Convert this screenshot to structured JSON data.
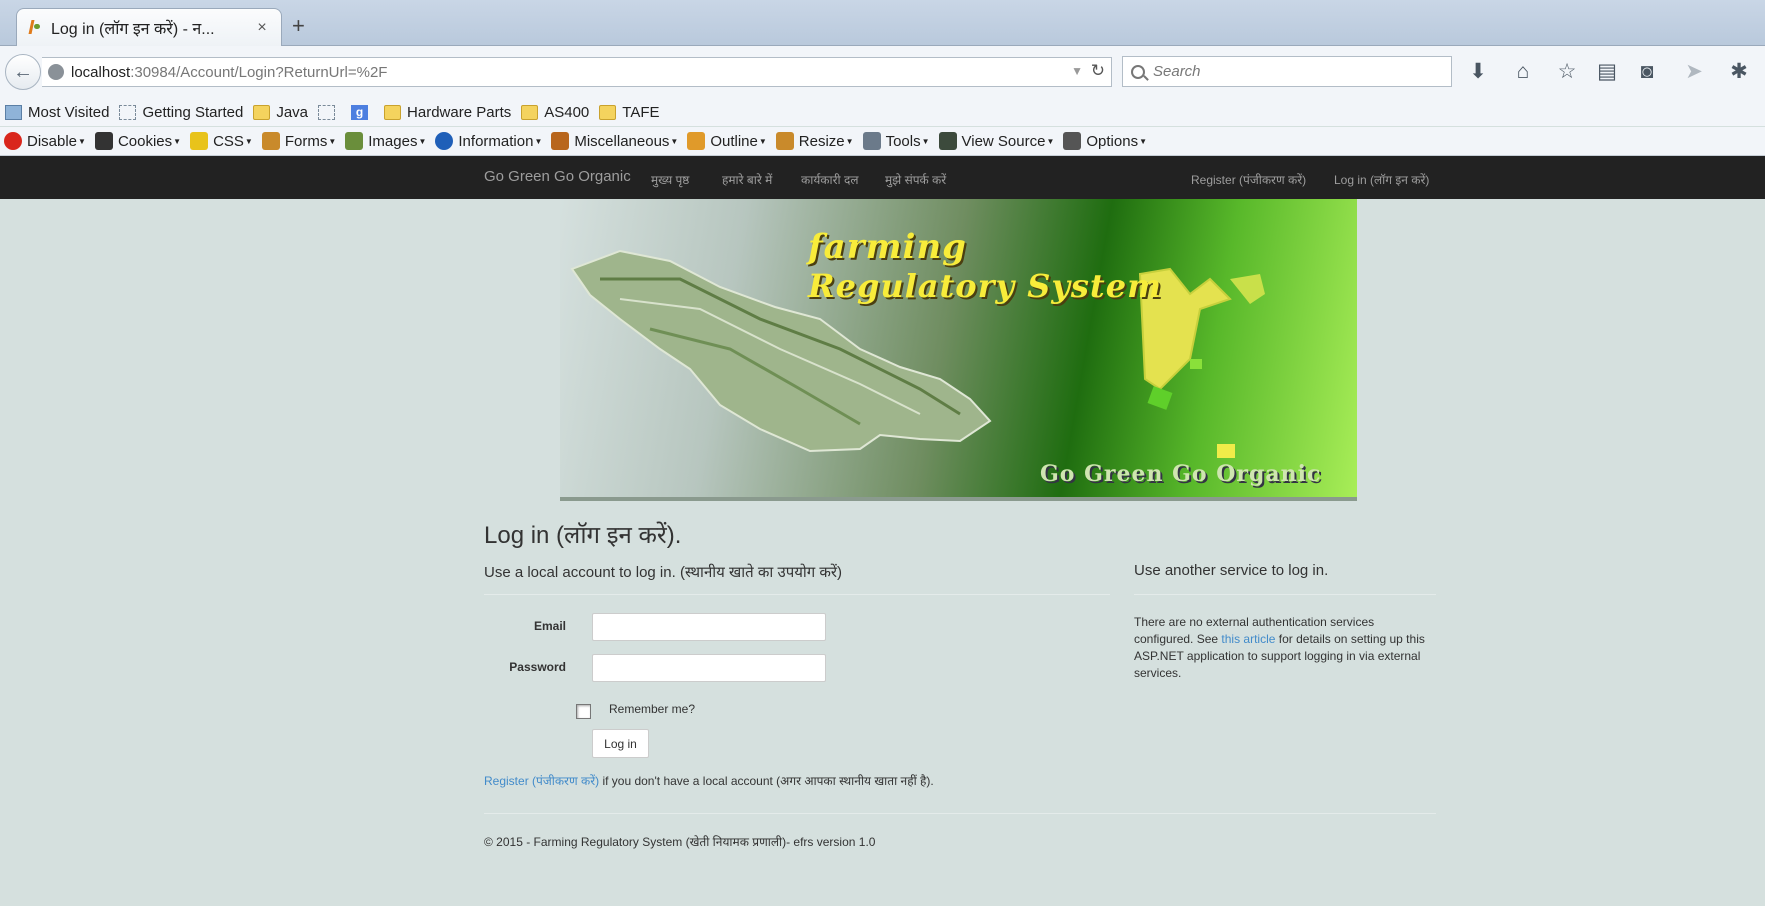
{
  "browser": {
    "tab_title": "Log in (लॉग इन करें) - न...",
    "tab_close": "×",
    "new_tab": "+",
    "url_host": "localhost",
    "url_rest": ":30984/Account/Login?ReturnUrl=%2F",
    "search_placeholder": "Search",
    "toolbar_icons": [
      "download-icon",
      "home-icon",
      "star-icon",
      "reading-list-icon",
      "pocket-icon",
      "send-icon",
      "firebug-icon"
    ],
    "bookmarks": [
      {
        "label": "Most Visited",
        "icon": "most-visited-icon"
      },
      {
        "label": "Getting Started",
        "icon": "dashed-page-icon"
      },
      {
        "label": "Java",
        "icon": "folder-icon"
      },
      {
        "label": "",
        "icon": "dashed-page-icon"
      },
      {
        "label": "",
        "icon": "google-icon"
      },
      {
        "label": "Hardware Parts",
        "icon": "folder-icon"
      },
      {
        "label": "AS400",
        "icon": "folder-icon"
      },
      {
        "label": "TAFE",
        "icon": "folder-icon"
      }
    ],
    "devtools": [
      {
        "label": "Disable",
        "icon": "disable-icon",
        "color": "#d9261c"
      },
      {
        "label": "Cookies",
        "icon": "cookies-icon",
        "color": "#333333"
      },
      {
        "label": "CSS",
        "icon": "css-icon",
        "color": "#e8c31b"
      },
      {
        "label": "Forms",
        "icon": "forms-icon",
        "color": "#c98a2b"
      },
      {
        "label": "Images",
        "icon": "images-icon",
        "color": "#6a8e3b"
      },
      {
        "label": "Information",
        "icon": "information-icon",
        "color": "#1f5fb8"
      },
      {
        "label": "Miscellaneous",
        "icon": "miscellaneous-icon",
        "color": "#b8661d"
      },
      {
        "label": "Outline",
        "icon": "outline-icon",
        "color": "#e09a2a"
      },
      {
        "label": "Resize",
        "icon": "resize-icon",
        "color": "#c98a2b"
      },
      {
        "label": "Tools",
        "icon": "tools-icon",
        "color": "#6b7a8a"
      },
      {
        "label": "View Source",
        "icon": "view-source-icon",
        "color": "#3c4a3c"
      },
      {
        "label": "Options",
        "icon": "options-icon",
        "color": "#555555"
      }
    ]
  },
  "site": {
    "brand": "Go Green Go Organic",
    "nav": [
      "मुख्य पृष्ठ",
      "हमारे बारे में",
      "कार्यकारी दल",
      "मुझे संपर्क करें"
    ],
    "register": "Register (पंजीकरण करें)",
    "login": "Log in (लॉग इन करें)"
  },
  "banner": {
    "title_line1": "farming",
    "title_line2": "Regulatory System",
    "tagline": "Go Green Go Organic"
  },
  "login": {
    "title": "Log in (लॉग इन करें).",
    "local_heading": "Use a local account to log in. (स्थानीय खाते का उपयोग करें)",
    "email_label": "Email",
    "email_value": "",
    "password_label": "Password",
    "password_value": "",
    "remember_label": "Remember me?",
    "button": "Log in",
    "register_link": "Register (पंजीकरण करें)",
    "register_suffix": " if you don't have a local account (अगर आपका स्थानीय खाता नहीं है)."
  },
  "external": {
    "heading": "Use another service to log in.",
    "text_before": "There are no external authentication services configured. See ",
    "link": "this article",
    "text_after": " for details on setting up this ASP.NET application to support logging in via external services."
  },
  "footer": "© 2015 - Farming Regulatory System (खेती नियामक प्रणाली)- efrs version 1.0",
  "colors": {
    "nav_bg": "#222222",
    "page_bg": "#d5e0de",
    "link": "#428bca",
    "banner_yellow": "#f8ec3a"
  }
}
